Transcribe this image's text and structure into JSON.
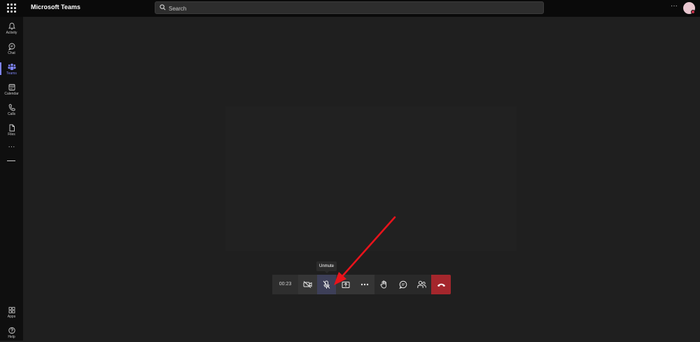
{
  "topbar": {
    "app_title": "Microsoft Teams",
    "search_placeholder": "Search",
    "more_label": "···"
  },
  "rail": {
    "items": [
      {
        "label": "Activity",
        "icon": "bell-icon",
        "active": false
      },
      {
        "label": "Chat",
        "icon": "chat-icon",
        "active": false
      },
      {
        "label": "Teams",
        "icon": "teams-icon",
        "active": true
      },
      {
        "label": "Calendar",
        "icon": "calendar-icon",
        "active": false
      },
      {
        "label": "Calls",
        "icon": "phone-icon",
        "active": false
      },
      {
        "label": "Files",
        "icon": "file-icon",
        "active": false
      }
    ],
    "more_label": "···",
    "bottom": [
      {
        "label": "Apps",
        "icon": "apps-icon"
      },
      {
        "label": "Help",
        "icon": "help-icon"
      }
    ]
  },
  "call": {
    "timer": "00:23",
    "tooltip": "Unmute",
    "buttons": [
      {
        "name": "camera-off",
        "icon": "camera-off-icon"
      },
      {
        "name": "mic-muted",
        "icon": "mic-off-icon",
        "highlighted": true
      },
      {
        "name": "share",
        "icon": "share-screen-icon"
      },
      {
        "name": "more",
        "icon": "more-horizontal-icon"
      },
      {
        "name": "raise-hand",
        "icon": "hand-icon"
      },
      {
        "name": "chat",
        "icon": "chat-icon"
      },
      {
        "name": "participants",
        "icon": "people-icon"
      },
      {
        "name": "leave",
        "icon": "hang-up-icon"
      }
    ]
  },
  "colors": {
    "accent": "#7f85f5",
    "leave": "#a4262c",
    "annotation_arrow": "#e8131b"
  }
}
